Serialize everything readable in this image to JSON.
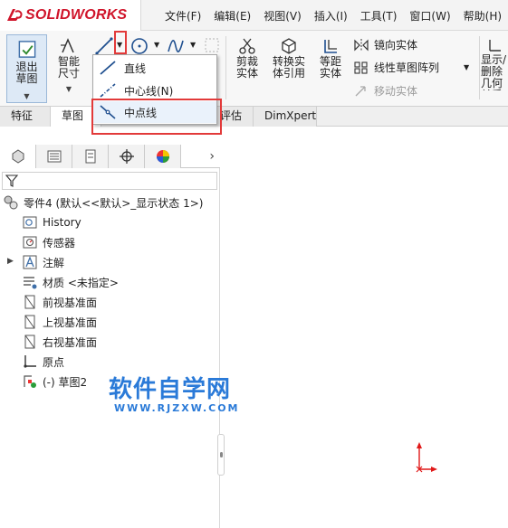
{
  "app": {
    "logo_text": "SOLIDWORKS",
    "menu": [
      "文件(F)",
      "编辑(E)",
      "视图(V)",
      "插入(I)",
      "工具(T)",
      "窗口(W)",
      "帮助(H)"
    ]
  },
  "ribbon": {
    "exit_sketch": "退出草图",
    "smart_dimension": "智能尺寸",
    "trim_entities": "剪裁实体",
    "convert_entities": "转换实体引用",
    "offset_entities": "等距实体",
    "mirror_entities": "镜向实体",
    "linear_pattern": "线性草图阵列",
    "move_entities": "移动实体",
    "show_delete_relations": "显示/删除几何关系"
  },
  "cmd_tabs": [
    "特征",
    "草图",
    "评估",
    "DimXpert"
  ],
  "line_dropdown": {
    "items": [
      "直线",
      "中心线(N)",
      "中点线"
    ],
    "highlighted": "中点线"
  },
  "panel": {
    "part_name": "零件4  (默认<<默认>_显示状态 1>)",
    "tree": [
      "History",
      "传感器",
      "注解",
      "材质 <未指定>",
      "前视基准面",
      "上视基准面",
      "右视基准面",
      "原点",
      "(-) 草图2"
    ]
  },
  "watermark": {
    "main": "软件自学网",
    "sub": "WWW.RJZXW.COM"
  },
  "colors": {
    "brand_red": "#d0152b",
    "highlight_red": "#e23a3a",
    "watermark_blue": "#2a7ad8"
  }
}
